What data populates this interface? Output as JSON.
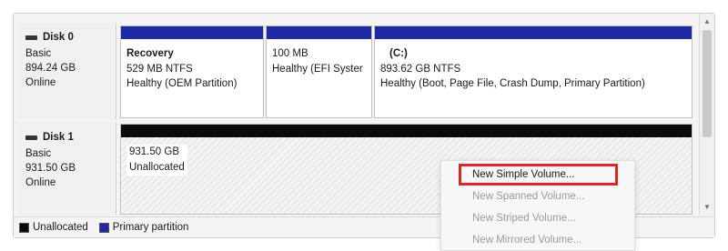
{
  "disks": [
    {
      "name": "Disk 0",
      "type": "Basic",
      "size": "894.24 GB",
      "status": "Online",
      "partitions": [
        {
          "name": "Recovery",
          "size": "529 MB NTFS",
          "status": "Healthy (OEM Partition)"
        },
        {
          "name": "",
          "size": "100 MB",
          "status": "Healthy (EFI Syster"
        },
        {
          "name": "(C:)",
          "size": "893.62 GB NTFS",
          "status": "Healthy (Boot, Page File, Crash Dump, Primary Partition)"
        }
      ]
    },
    {
      "name": "Disk 1",
      "type": "Basic",
      "size": "931.50 GB",
      "status": "Online",
      "unallocated": {
        "size": "931.50 GB",
        "label": "Unallocated"
      }
    }
  ],
  "context_menu": {
    "items": [
      {
        "label": "New Simple Volume...",
        "enabled": true
      },
      {
        "label": "New Spanned Volume...",
        "enabled": false
      },
      {
        "label": "New Striped Volume...",
        "enabled": false
      },
      {
        "label": "New Mirrored Volume...",
        "enabled": false
      }
    ]
  },
  "legend": {
    "items": [
      {
        "label": "Unallocated",
        "color": "#0a0a0a"
      },
      {
        "label": "Primary partition",
        "color": "#1d2aa3"
      }
    ]
  },
  "colors": {
    "primary_partition": "#1d2aa3",
    "unallocated": "#0a0a0a",
    "highlight": "#d9262a"
  }
}
